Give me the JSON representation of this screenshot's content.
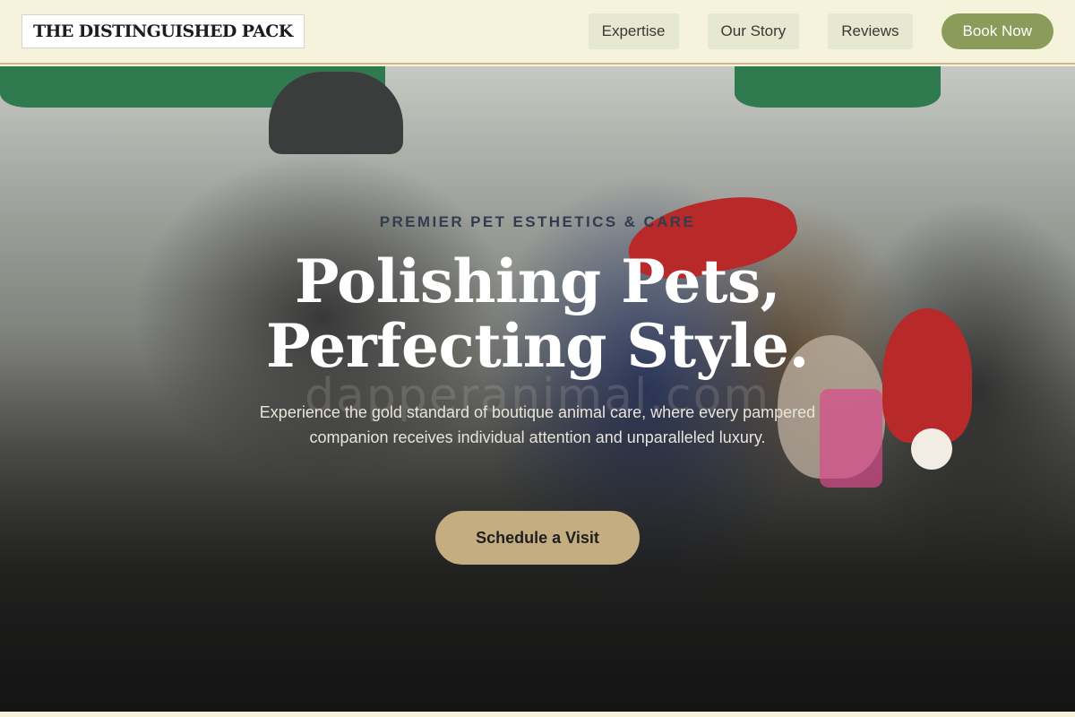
{
  "header": {
    "logo": "THE DISTINGUISHED PACK",
    "nav": [
      {
        "label": "Expertise"
      },
      {
        "label": "Our Story"
      },
      {
        "label": "Reviews"
      }
    ],
    "book_label": "Book Now"
  },
  "hero": {
    "eyebrow": "PREMIER PET ESTHETICS & CARE",
    "headline_line1": "Polishing Pets,",
    "headline_line2": "Perfecting Style.",
    "subtext": "Experience the gold standard of boutique animal care, where every pampered companion receives individual attention and unparalleled luxury.",
    "cta_label": "Schedule a Visit",
    "watermark": "dapperanimal.com"
  },
  "colors": {
    "header_bg": "#f5f3dc",
    "nav_bg": "#e6e8cf",
    "book_bg": "#8b9b5a",
    "cta_bg": "#c4ad80",
    "eyebrow": "#323c4f"
  }
}
